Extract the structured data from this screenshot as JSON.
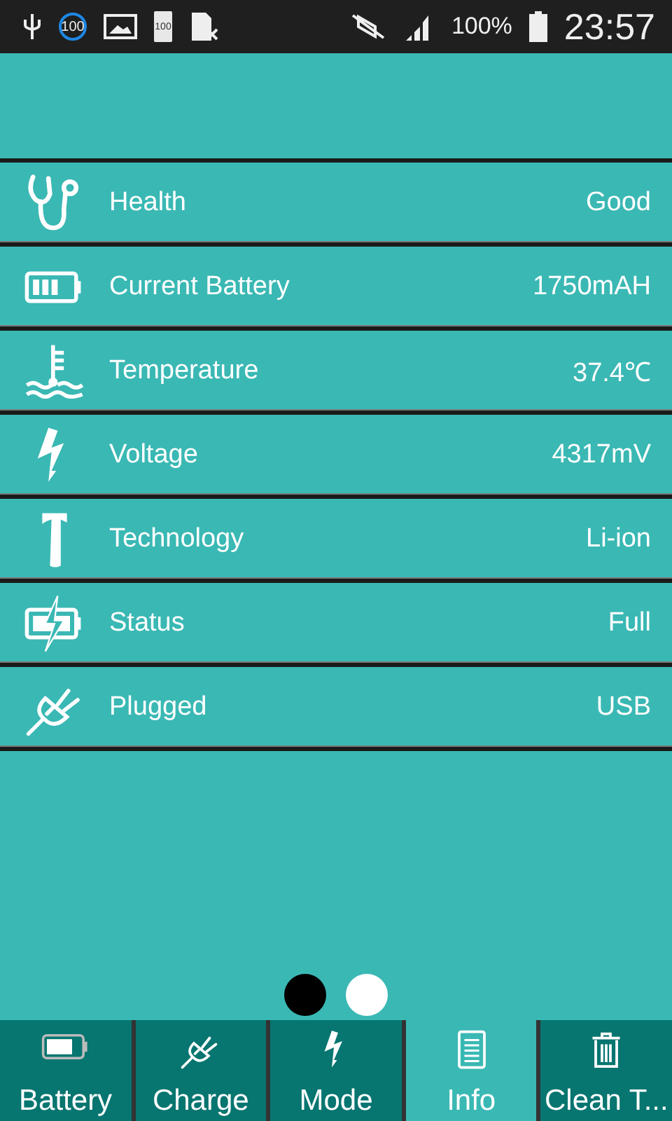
{
  "status_bar": {
    "badges": [
      "100",
      "100"
    ],
    "battery": "100%",
    "time": "23:57"
  },
  "rows": [
    {
      "kind": "stethoscope",
      "label": "Health",
      "value": "Good"
    },
    {
      "kind": "battery",
      "label": "Current Battery",
      "value": "1750mAH"
    },
    {
      "kind": "thermometer",
      "label": "Temperature",
      "value": "37.4℃"
    },
    {
      "kind": "bolt",
      "label": "Voltage",
      "value": "4317mV"
    },
    {
      "kind": "hammer",
      "label": "Technology",
      "value": "Li-ion"
    },
    {
      "kind": "charging",
      "label": "Status",
      "value": "Full"
    },
    {
      "kind": "plug",
      "label": "Plugged",
      "value": "USB"
    }
  ],
  "pages": [
    {
      "selected": true
    },
    {
      "selected": false
    }
  ],
  "tabs": [
    {
      "kind": "battery",
      "label": "Battery",
      "selected": false
    },
    {
      "kind": "plug",
      "label": "Charge",
      "selected": false
    },
    {
      "kind": "bolt",
      "label": "Mode",
      "selected": false
    },
    {
      "kind": "list",
      "label": "Info",
      "selected": true
    },
    {
      "kind": "trash",
      "label": "Clean T...",
      "selected": false
    }
  ]
}
